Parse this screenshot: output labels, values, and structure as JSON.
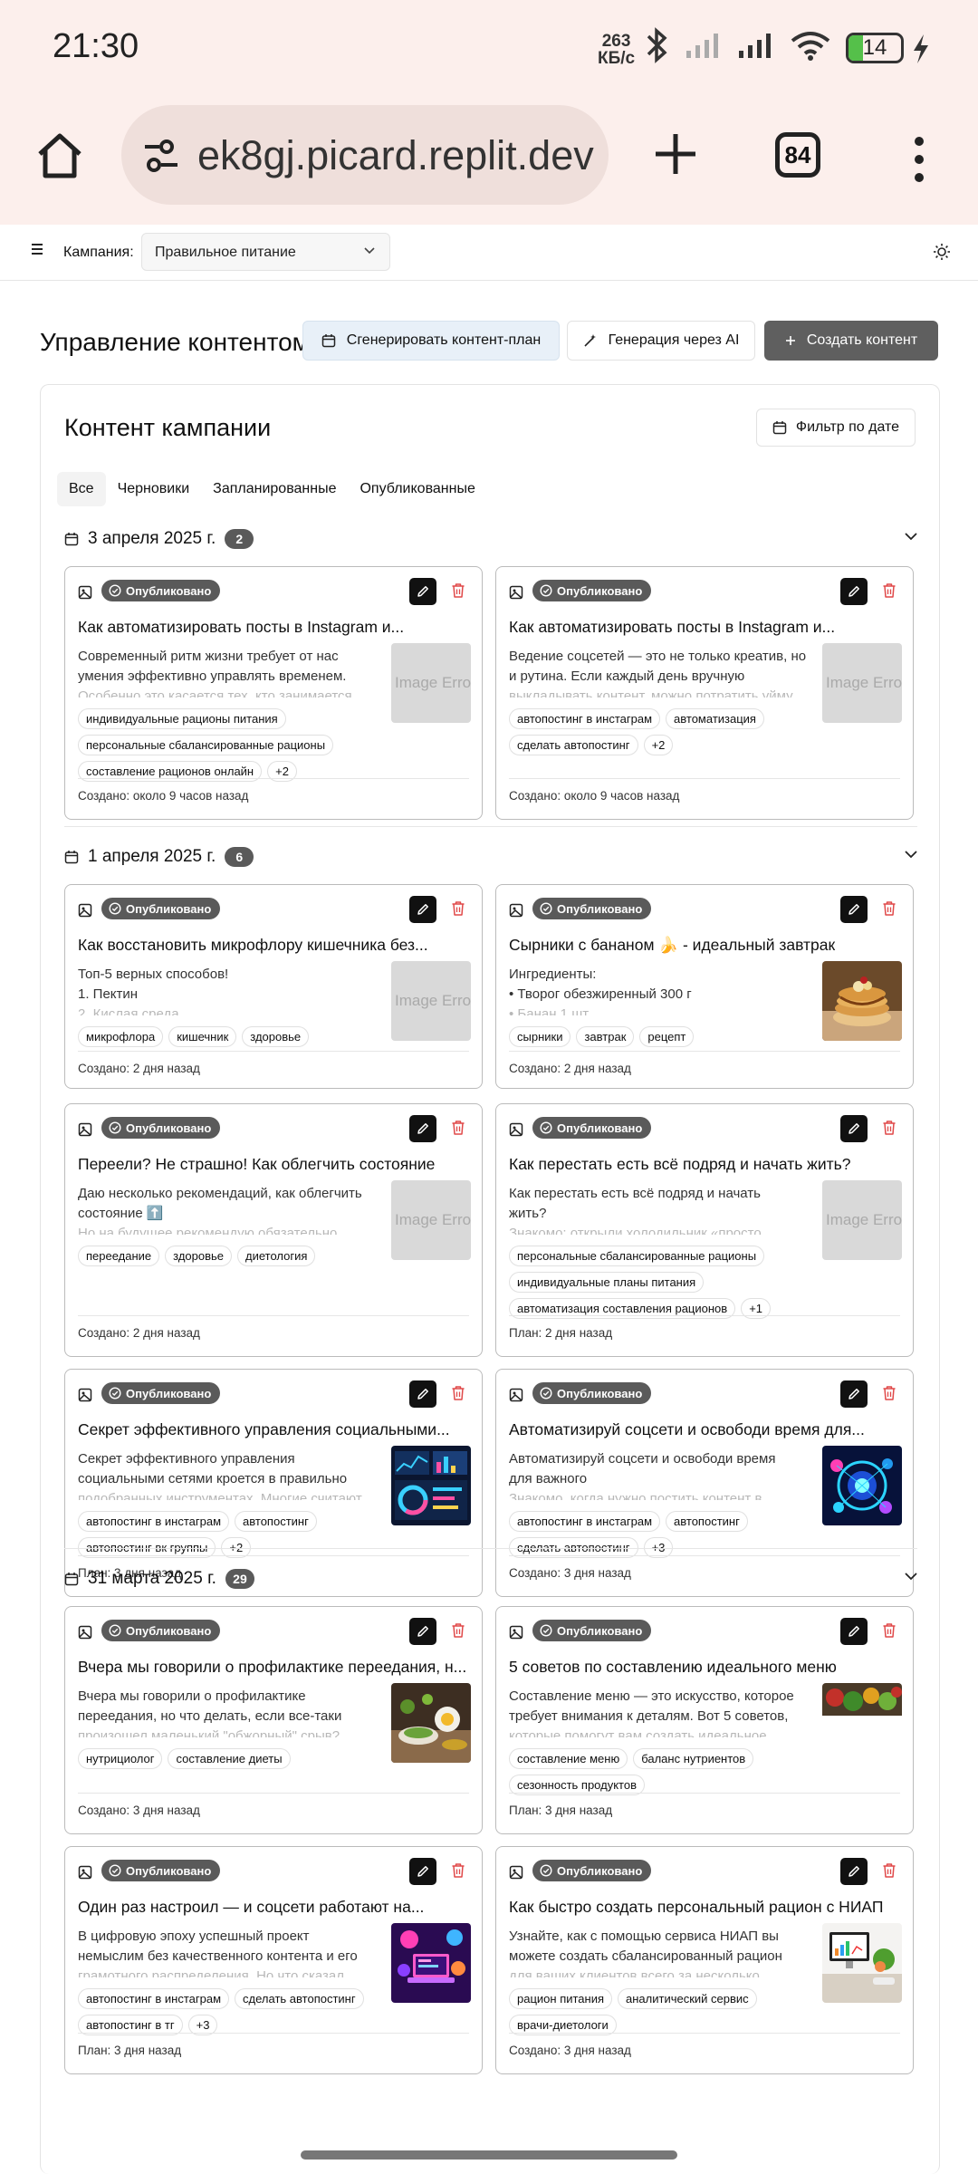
{
  "status": {
    "time": "21:30",
    "net_value": "263",
    "net_unit": "КБ/с",
    "battery": "14"
  },
  "browser": {
    "url": "ek8gj.picard.replit.dev",
    "tab_count": "84"
  },
  "appbar": {
    "campaign_label": "Кампания:",
    "campaign_value": "Правильное питание"
  },
  "page": {
    "title": "Управление контентом",
    "btn_plan": "Сгенерировать контент-план",
    "btn_ai": "Генерация через AI",
    "btn_create": "Создать контент"
  },
  "content": {
    "title": "Контент кампании",
    "date_filter": "Фильтр по дате",
    "tabs": [
      "Все",
      "Черновики",
      "Запланированные",
      "Опубликованные"
    ]
  },
  "colors": {
    "accent_dark": "#111111",
    "delete_red": "#e04848",
    "badge_bg": "#5a5a5a",
    "status_bg": "#fcefec"
  },
  "groups": [
    {
      "date": "3 апреля 2025 г.",
      "count": "2",
      "cards": [
        {
          "status": "Опубликовано",
          "title": "Как автоматизировать посты в Instagram и...",
          "body": [
            "Современный ритм жизни требует от нас",
            "умения эффективно управлять временем.",
            "Особенно это касается тех, кто занимается"
          ],
          "image": "Image Error",
          "tags": [
            "индивидуальные рационы питания",
            "персональные сбалансированные рационы",
            "составление рационов онлайн",
            "+2"
          ],
          "footer": "Создано: около 9 часов назад"
        },
        {
          "status": "Опубликовано",
          "title": "Как автоматизировать посты в Instagram и...",
          "body": [
            "Ведение соцсетей — это не только креатив, но",
            "и рутина. Если каждый день вручную",
            "выкладывать контент, можно потратить уйму"
          ],
          "image": "Image Error",
          "tags": [
            "автопостинг в инстаграм",
            "автоматизация",
            "сделать автопостинг",
            "+2"
          ],
          "footer": "Создано: около 9 часов назад"
        }
      ]
    },
    {
      "date": "1 апреля 2025 г.",
      "count": "6",
      "cards": [
        {
          "status": "Опубликовано",
          "title": "Как восстановить микрофлору кишечника без...",
          "body": [
            "Топ-5 верных способов!",
            "1.  Пектин",
            "2.  Кислая среда"
          ],
          "image": "Image Error",
          "tags": [
            "микрофлора",
            "кишечник",
            "здоровье"
          ],
          "footer": "Создано: 2 дня назад"
        },
        {
          "status": "Опубликовано",
          "title": "Сырники с бананом 🍌 - идеальный завтрак",
          "body": [
            "Ингредиенты:",
            "•  Творог обезжиренный 300 г",
            "•  Банан 1 шт"
          ],
          "image": "pancakes",
          "tags": [
            "сырники",
            "завтрак",
            "рецепт"
          ],
          "footer": "Создано: 2 дня назад"
        },
        {
          "status": "Опубликовано",
          "title": "Переели? Не страшно! Как облегчить состояние",
          "body": [
            "Даю несколько рекомендаций, как облегчить",
            "состояние ⬆️",
            "Но на будущее рекомендую обязательно"
          ],
          "image": "Image Error",
          "tags": [
            "переедание",
            "здоровье",
            "диетология"
          ],
          "footer": "Создано: 2 дня назад"
        },
        {
          "status": "Опубликовано",
          "title": "Как перестать есть всё подряд и начать жить?",
          "body": [
            "Как перестать есть всё подряд и начать",
            "жить?",
            "Знакомо: открыли холодильник «просто"
          ],
          "image": "Image Error",
          "tags": [
            "персональные сбалансированные рационы",
            "индивидуальные планы питания",
            "автоматизация составления рационов",
            "+1"
          ],
          "footer": "План: 2 дня назад"
        },
        {
          "status": "Опубликовано",
          "title": "Секрет эффективного управления социальными...",
          "body": [
            "Секрет эффективного управления",
            "социальными сетями кроется в правильно",
            "подобранных инструментах. Многие считают"
          ],
          "image": "dashboard",
          "tags": [
            "автопостинг в инстаграм",
            "автопостинг",
            "автопостинг вк группы",
            "+2"
          ],
          "footer": "План: 3 дня назад"
        },
        {
          "status": "Опубликовано",
          "title": "Автоматизируй соцсети и освободи время для...",
          "body": [
            "Автоматизируй соцсети и освободи время",
            "для важного",
            "Знакомо, когда нужно постить контент в"
          ],
          "image": "neon",
          "tags": [
            "автопостинг в инстаграм",
            "автопостинг",
            "сделать автопостинг",
            "+3"
          ],
          "footer": "Создано: 3 дня назад"
        }
      ]
    },
    {
      "date": "31 марта 2025 г.",
      "count": "29",
      "cards": [
        {
          "status": "Опубликовано",
          "title": "Вчера мы говорили о профилактике переедания, н...",
          "body": [
            "Вчера мы говорили о профилактике",
            "переедания, но что делать, если все-таки",
            "произошел маленький \"обжорный\" срыв?"
          ],
          "image": "food",
          "tags": [
            "нутрициолог",
            "составление диеты"
          ],
          "footer": "Создано: 3 дня назад"
        },
        {
          "status": "Опубликовано",
          "title": "5 советов по составлению идеального меню",
          "body": [
            "Составление меню — это искусство, которое",
            "требует внимания к деталям. Вот 5 советов,",
            "которые помогут вам создать идеальное"
          ],
          "image": "veg",
          "tags": [
            "составление меню",
            "баланс нутриентов",
            "сезонность продуктов"
          ],
          "footer": "План: 3 дня назад"
        },
        {
          "status": "Опубликовано",
          "title": "Один раз настроил — и соцсети работают на...",
          "body": [
            "В цифровую эпоху успешный проект",
            "немыслим без качественного контента и его",
            "грамотного распределения. Но что сказал"
          ],
          "image": "laptop",
          "tags": [
            "автопостинг в инстаграм",
            "сделать автопостинг",
            "автопостинг в тг",
            "+3"
          ],
          "footer": "План: 3 дня назад"
        },
        {
          "status": "Опубликовано",
          "title": "Как быстро создать персональный рацион с НИАП",
          "body": [
            "Узнайте, как с помощью сервиса НИАП вы",
            "можете создать сбалансированный рацион",
            "для ваших клиентов всего за несколько"
          ],
          "image": "desk",
          "tags": [
            "рацион питания",
            "аналитический сервис",
            "врачи-диетологи"
          ],
          "footer": "Создано: 3 дня назад"
        }
      ]
    }
  ]
}
